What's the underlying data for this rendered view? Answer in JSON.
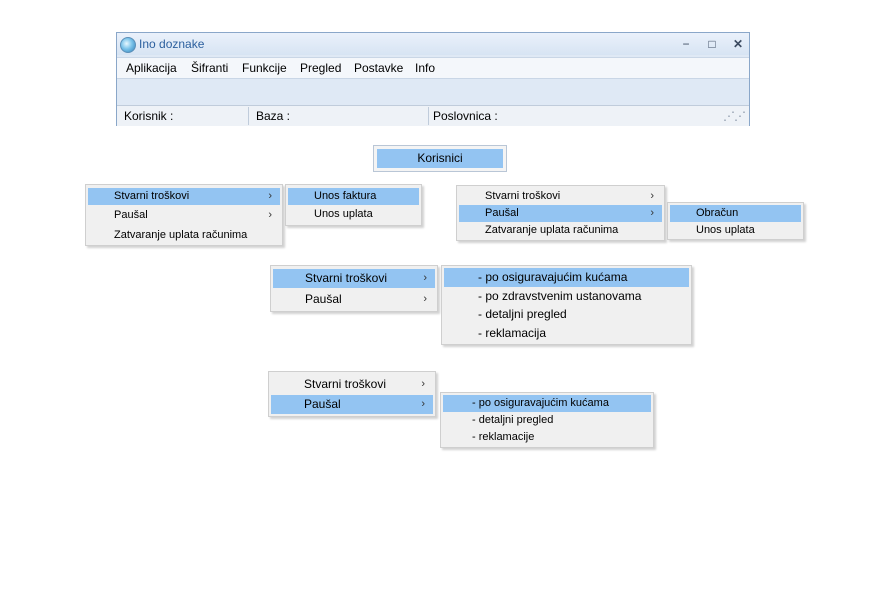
{
  "window": {
    "title": "Ino doznake",
    "controls": {
      "minimize": "−",
      "maximize": "□",
      "close": "✕"
    },
    "menubar": [
      "Aplikacija",
      "Šifranti",
      "Funkcije",
      "Pregled",
      "Postavke",
      "Info"
    ],
    "status": {
      "korisnik": "Korisnik :",
      "baza": "Baza :",
      "poslovnica": "Poslovnica :"
    }
  },
  "korisnici": "Korisnici",
  "menu1": {
    "main": [
      "Stvarni troškovi",
      "Paušal",
      "Zatvaranje uplata računima"
    ],
    "sub": [
      "Unos faktura",
      "Unos uplata"
    ]
  },
  "menu2": {
    "main": [
      "Stvarni troškovi",
      "Paušal",
      "Zatvaranje uplata računima"
    ],
    "sub": [
      "Obračun",
      "Unos uplata"
    ]
  },
  "menu3": {
    "main": [
      "Stvarni troškovi",
      "Paušal"
    ],
    "sub": [
      "- po osiguravajućim kućama",
      "- po zdravstvenim ustanovama",
      "- detaljni pregled",
      "- reklamacija"
    ]
  },
  "menu4": {
    "main": [
      "Stvarni troškovi",
      "Paušal"
    ],
    "sub": [
      "- po osiguravajućim kućama",
      "- detaljni pregled",
      "- reklamacije"
    ]
  },
  "glyphs": {
    "arrow": "›",
    "grip": "⋰⋰"
  },
  "colors": {
    "highlight": "#93c4f2",
    "menu_bg": "#f0f0f0"
  }
}
